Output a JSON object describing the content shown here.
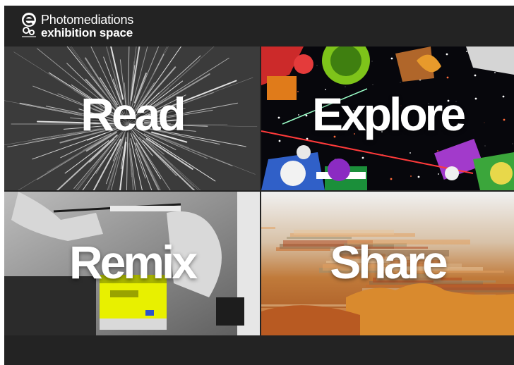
{
  "brand": {
    "line1": "Photomediations",
    "line2": "exhibition space",
    "logo_icon": "photomediations-e-logo-icon"
  },
  "tiles": [
    {
      "label": "Read",
      "theme": "burst of white lines on dark grey"
    },
    {
      "label": "Explore",
      "theme": "colourful space collage"
    },
    {
      "label": "Remix",
      "theme": "black and white hands with yellow glitch"
    },
    {
      "label": "Share",
      "theme": "blurred autumn landscape"
    }
  ],
  "colors": {
    "frame_bg": "#232323",
    "label": "#ffffff",
    "glitch_yellow": "#e8f000"
  }
}
